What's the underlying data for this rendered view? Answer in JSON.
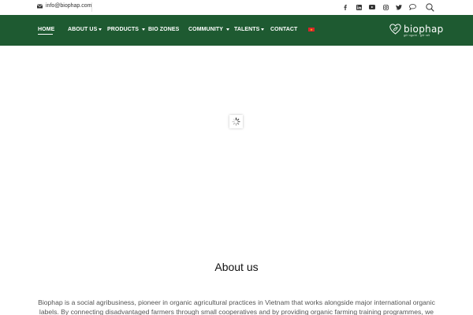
{
  "topbar": {
    "email": "info@biophap.com",
    "icons": [
      "mail-icon",
      "facebook-icon",
      "linkedin-icon",
      "youtube-icon",
      "instagram-icon",
      "twitter-icon",
      "chat-bubble-icon",
      "search-icon"
    ]
  },
  "nav": {
    "items": [
      {
        "label": "HOME",
        "active": true,
        "dropdown": false
      },
      {
        "label": "ABOUT US",
        "active": false,
        "dropdown": true
      },
      {
        "label": "PRODUCTS",
        "active": false,
        "dropdown": true
      },
      {
        "label": "BIO ZONES",
        "active": false,
        "dropdown": false
      },
      {
        "label": "COMMUNITY",
        "active": false,
        "dropdown": true
      },
      {
        "label": "TALENTS",
        "active": false,
        "dropdown": true
      },
      {
        "label": "CONTACT",
        "active": false,
        "dropdown": false
      }
    ],
    "language_flag": "vietnam-flag-icon"
  },
  "logo": {
    "brand": "biophap",
    "tagline": "gửi người - giữ nết"
  },
  "colors": {
    "nav_background": "#1e5a31",
    "nav_text": "#ffffff"
  },
  "about": {
    "title": "About us",
    "text": "Biophap is a social agribusiness, pioneer in organic agricultural practices in Vietnam that works alongside major international organic labels. By connecting disadvantaged farmers through small cooperatives and by providing organic farming training programmes, we help"
  }
}
